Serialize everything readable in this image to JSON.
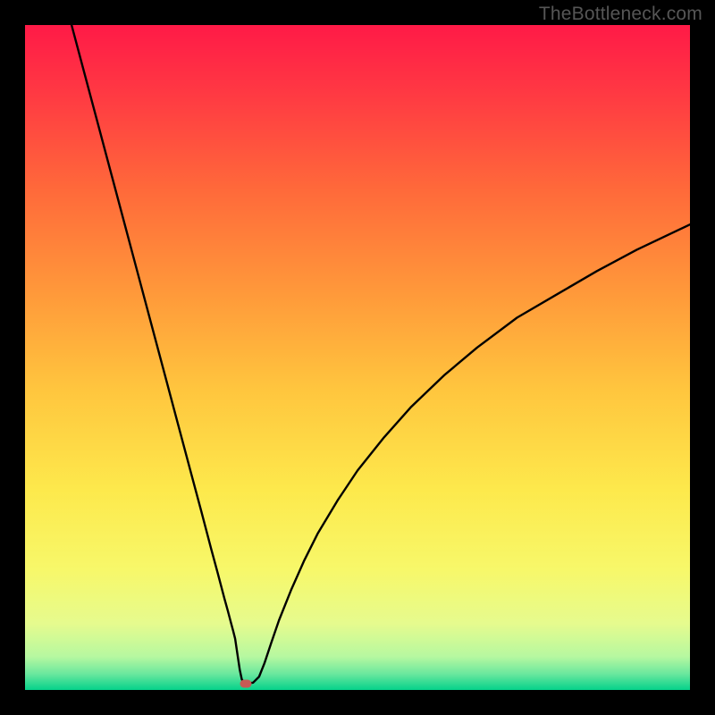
{
  "watermark": "TheBottleneck.com",
  "chart_data": {
    "type": "line",
    "title": "",
    "xlabel": "",
    "ylabel": "",
    "xlim": [
      0,
      100
    ],
    "ylim": [
      0,
      100
    ],
    "grid": false,
    "gradient_stops": [
      {
        "offset": 0.0,
        "color": "#ff1a47"
      },
      {
        "offset": 0.1,
        "color": "#ff3843"
      },
      {
        "offset": 0.25,
        "color": "#ff6a3a"
      },
      {
        "offset": 0.4,
        "color": "#ff983a"
      },
      {
        "offset": 0.55,
        "color": "#ffc63e"
      },
      {
        "offset": 0.7,
        "color": "#fde94c"
      },
      {
        "offset": 0.82,
        "color": "#f7f86a"
      },
      {
        "offset": 0.9,
        "color": "#e6fb8e"
      },
      {
        "offset": 0.95,
        "color": "#b6f8a0"
      },
      {
        "offset": 0.975,
        "color": "#6de89e"
      },
      {
        "offset": 1.0,
        "color": "#05d28b"
      }
    ],
    "series": [
      {
        "name": "curve",
        "color": "#000000",
        "stroke_width": 2.4,
        "x": [
          7.0,
          9.0,
          11.0,
          13.0,
          15.0,
          17.0,
          19.0,
          21.0,
          23.0,
          25.0,
          26.5,
          28.0,
          29.0,
          30.0,
          30.5,
          31.0,
          31.3,
          31.6,
          32.0,
          32.3,
          32.6,
          33.0,
          33.6,
          34.3,
          35.2,
          36.0,
          37.0,
          38.2,
          40.0,
          42.0,
          44.0,
          47.0,
          50.0,
          54.0,
          58.0,
          63.0,
          68.0,
          74.0,
          80.0,
          86.0,
          92.0,
          100.0
        ],
        "y": [
          100.0,
          92.5,
          85.0,
          77.5,
          70.0,
          62.5,
          55.0,
          47.5,
          40.0,
          32.5,
          26.9,
          21.2,
          17.5,
          13.7,
          11.9,
          10.0,
          8.9,
          7.7,
          5.0,
          3.0,
          1.6,
          1.0,
          1.0,
          1.1,
          2.0,
          4.0,
          7.0,
          10.5,
          15.0,
          19.5,
          23.5,
          28.5,
          33.0,
          38.0,
          42.5,
          47.3,
          51.5,
          56.0,
          59.5,
          63.0,
          66.2,
          70.0
        ]
      }
    ],
    "marker": {
      "x": 33.2,
      "y": 1.0,
      "color": "#c65a55"
    }
  }
}
